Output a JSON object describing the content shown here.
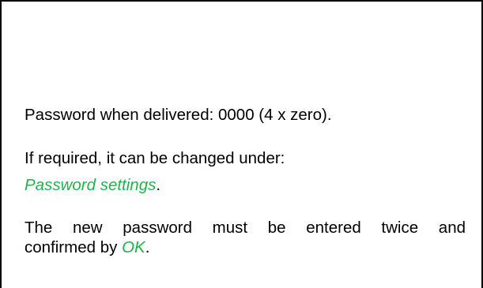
{
  "colors": {
    "text": "#000000",
    "accent_green": "#1fb34a",
    "border": "#000000"
  },
  "paragraph1": {
    "text": "Password when delivered: 0000 (4 x zero)."
  },
  "paragraph2": {
    "line1": "If required, it can be changed under:",
    "link": "Password settings",
    "link_suffix": "."
  },
  "paragraph3": {
    "line1": "The new password must be entered twice and",
    "line2_prefix": "confirmed by ",
    "ok_link": "OK",
    "line2_suffix": "."
  }
}
